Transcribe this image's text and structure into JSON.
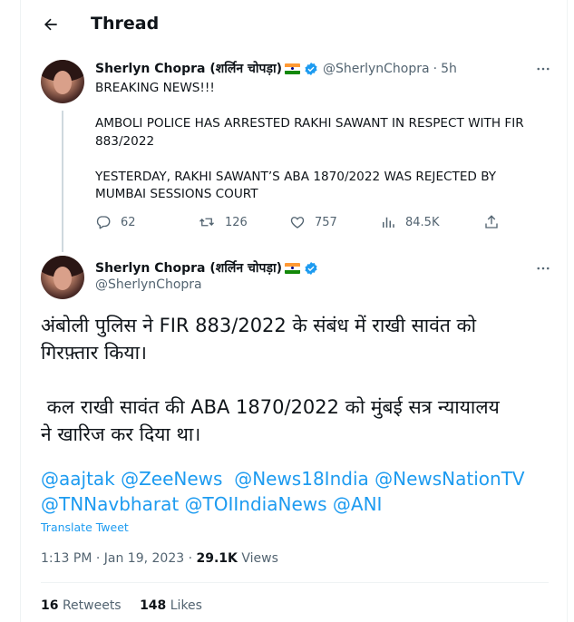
{
  "header": {
    "title": "Thread"
  },
  "reply_tweet": {
    "author_name": "Sherlyn Chopra (शर्लिन चोपड़ा)",
    "author_handle": "@SherlynChopra",
    "time": "5h",
    "paragraphs": [
      "BREAKING NEWS!!!",
      "AMBOLI POLICE HAS ARRESTED RAKHI SAWANT IN RESPECT WITH FIR 883/2022",
      "YESTERDAY, RAKHI SAWANT’S ABA 1870/2022 WAS REJECTED BY MUMBAI SESSIONS COURT"
    ],
    "stats": {
      "replies": "62",
      "retweets": "126",
      "likes": "757",
      "views": "84.5K"
    }
  },
  "main_tweet": {
    "author_name": "Sherlyn Chopra (शर्लिन चोपड़ा)",
    "author_handle": "@SherlynChopra",
    "text_lines": [
      "अंबोली पुलिस ने FIR 883/2022 के संबंध में राखी सावंत को",
      "गिरफ़्तार किया।",
      " कल राखी सावंत की ABA 1870/2022 को मुंबई सत्र न्यायालय",
      "ने खारिज कर दिया था।"
    ],
    "mentions_line1": [
      "@aajtak",
      "@ZeeNews",
      "@News18India",
      "@NewsNationTV"
    ],
    "mentions_line2": [
      "@TNNavbharat",
      "@TOIIndiaNews",
      "@ANI"
    ],
    "translate_label": "Translate Tweet",
    "timestamp": "1:13 PM · Jan 19, 2023",
    "views_count": "29.1K",
    "views_label": "Views",
    "retweets_count": "16",
    "retweets_label": "Retweets",
    "likes_count": "148",
    "likes_label": "Likes"
  },
  "colors": {
    "accent": "#1d9bf0",
    "muted": "#536471",
    "text": "#0f1419",
    "border": "#eff3f4"
  },
  "icons": [
    "back-arrow-icon",
    "verified-badge-icon",
    "more-icon",
    "reply-icon",
    "retweet-icon",
    "like-icon",
    "views-icon",
    "share-icon",
    "india-flag-icon"
  ]
}
